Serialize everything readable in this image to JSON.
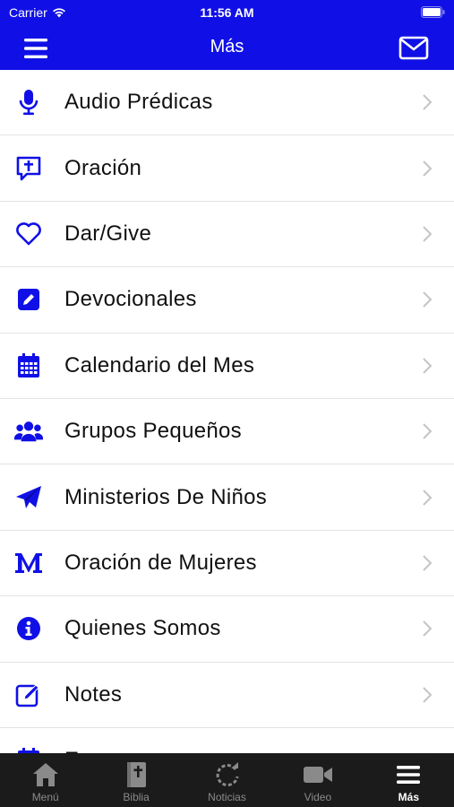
{
  "status_bar": {
    "carrier": "Carrier",
    "time": "11:56 AM"
  },
  "nav": {
    "title": "Más"
  },
  "accent_color": "#1010e6",
  "menu_items": [
    {
      "label": "Audio Prédicas",
      "icon": "microphone-icon"
    },
    {
      "label": "Oración",
      "icon": "prayer-chat-icon"
    },
    {
      "label": "Dar/Give",
      "icon": "heart-icon"
    },
    {
      "label": "Devocionales",
      "icon": "pencil-square-icon"
    },
    {
      "label": "Calendario del Mes",
      "icon": "calendar-icon"
    },
    {
      "label": "Grupos Pequeños",
      "icon": "users-icon"
    },
    {
      "label": "Ministerios De Niños",
      "icon": "paper-plane-icon"
    },
    {
      "label": "Oración de Mujeres",
      "icon": "letter-m-icon"
    },
    {
      "label": "Quienes Somos",
      "icon": "info-icon"
    },
    {
      "label": "Notes",
      "icon": "edit-icon"
    },
    {
      "label": "E",
      "icon": "calendar-icon"
    }
  ],
  "tabs": [
    {
      "label": "Menú",
      "icon": "home-icon"
    },
    {
      "label": "Biblia",
      "icon": "bible-icon"
    },
    {
      "label": "Noticias",
      "icon": "refresh-icon"
    },
    {
      "label": "Video",
      "icon": "video-camera-icon"
    },
    {
      "label": "Más",
      "icon": "hamburger-icon",
      "active": true
    }
  ]
}
